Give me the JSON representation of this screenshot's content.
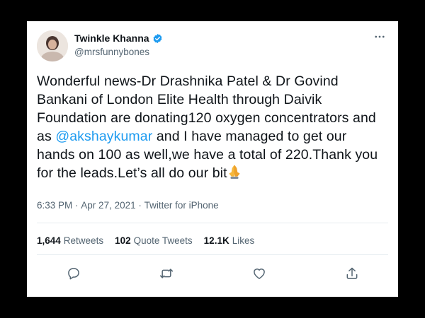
{
  "tweet": {
    "author": {
      "display_name": "Twinkle Khanna",
      "handle": "@mrsfunnybones",
      "verified": true
    },
    "text_before_mention": "Wonderful news-Dr Drashnika Patel & Dr Govind\nBankani of London Elite Health through Daivik\nFoundation are donating120 oxygen concentrators and\nas ",
    "mention": "@akshaykumar",
    "text_after_mention": " and I have managed to get our\nhands on 100 as well,we have a total of 220.Thank you\nfor the leads.Let’s all do our bit",
    "emoji": "folded-hands",
    "time": "6:33 PM",
    "date": "Apr 27, 2021",
    "source": "Twitter for iPhone",
    "stats": {
      "retweets_count": "1,644",
      "retweets_label": "Retweets",
      "quotes_count": "102",
      "quotes_label": "Quote Tweets",
      "likes_count": "12.1K",
      "likes_label": "Likes"
    }
  },
  "colors": {
    "accent": "#1d9bf0",
    "text": "#0f1419",
    "secondary": "#536471",
    "divider": "#e6ecf0",
    "frame": "#000000"
  },
  "icons": {
    "more": "more-dots-icon",
    "verified": "verified-badge-icon",
    "reply": "reply-icon",
    "retweet": "retweet-icon",
    "like": "heart-icon",
    "share": "share-icon"
  }
}
